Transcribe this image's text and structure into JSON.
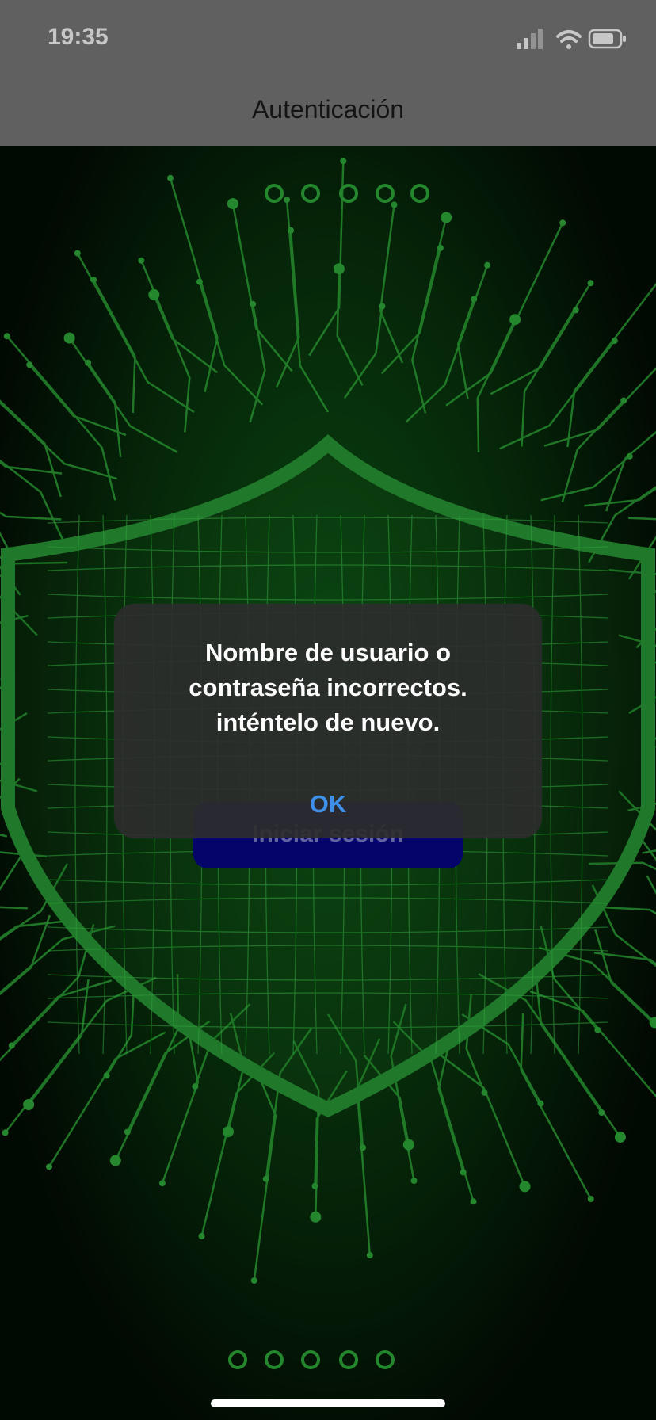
{
  "status_bar": {
    "time": "19:35",
    "icons": [
      "signal-icon",
      "wifi-icon",
      "battery-icon"
    ]
  },
  "header": {
    "title": "Autenticación"
  },
  "login": {
    "button_label": "Iniciar sesión"
  },
  "alert": {
    "message_line1": "Nombre de usuario o",
    "message_line2": "contraseña incorrectos.",
    "message_line3": "inténtelo de nuevo.",
    "ok_label": "OK"
  },
  "colors": {
    "background": "#041a08",
    "circuit": "#2fae3a",
    "header": "#7b7b7b",
    "alert_bg": "#2c2c2c",
    "alert_action": "#3d8fe8",
    "login_button": "#06068a"
  }
}
